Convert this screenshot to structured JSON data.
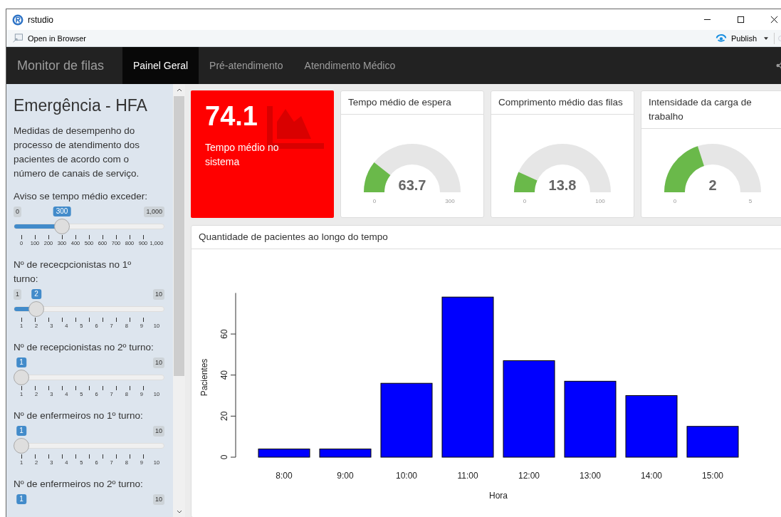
{
  "window": {
    "title": "rstudio"
  },
  "toolbar": {
    "open_in_browser": "Open in Browser",
    "publish": "Publish"
  },
  "navbar": {
    "brand": "Monitor de filas",
    "tabs": [
      {
        "label": "Painel Geral",
        "selected": true
      },
      {
        "label": "Pré-atendimento",
        "selected": false
      },
      {
        "label": "Atendimento Médico",
        "selected": false
      }
    ]
  },
  "sidebar": {
    "title": "Emergência - HFA",
    "description": "Medidas de desempenho do processo de atendimento dos pacientes de acordo com o número de canais de serviço.",
    "sliders": [
      {
        "label": "Aviso se tempo médio exceder:",
        "min": "0",
        "max": "1,000",
        "value": "300",
        "level": 0.3,
        "ticks": [
          "0",
          "100",
          "200",
          "300",
          "400",
          "500",
          "600",
          "700",
          "800",
          "900",
          "1,000"
        ]
      },
      {
        "label": "Nº de rececpcionistas no 1º turno:",
        "min": "1",
        "max": "10",
        "value": "2",
        "level": 0.111,
        "ticks": [
          "1",
          "2",
          "3",
          "4",
          "5",
          "6",
          "7",
          "8",
          "9",
          "10"
        ]
      },
      {
        "label": "Nº de recepcionistas no 2º turno:",
        "max": "10",
        "value": "1",
        "level": 0,
        "ticks": [
          "1",
          "2",
          "3",
          "4",
          "5",
          "6",
          "7",
          "8",
          "9",
          "10"
        ]
      },
      {
        "label": "Nº de enfermeiros no 1º turno:",
        "max": "10",
        "value": "1",
        "level": 0,
        "ticks": [
          "1",
          "2",
          "3",
          "4",
          "5",
          "6",
          "7",
          "8",
          "9",
          "10"
        ]
      },
      {
        "label": "Nº de enfermeiros no 2º turno:",
        "max": "10",
        "value": "1"
      }
    ]
  },
  "value_box": {
    "value": "74.1",
    "caption": "Tempo médio no sistema",
    "color": "#ff0000"
  },
  "gauges": [
    {
      "title": "Tempo médio de espera",
      "value": "63.7",
      "min": "0",
      "max": "300",
      "level": 0.212
    },
    {
      "title": "Comprimento médio das filas",
      "value": "13.8",
      "min": "0",
      "max": "100",
      "level": 0.138
    },
    {
      "title": "Intensidade da carga de trabalho",
      "value": "2",
      "min": "0",
      "max": "5",
      "level": 0.4
    }
  ],
  "chart_panel": {
    "title": "Quantidade de pacientes ao longo do tempo",
    "chart_data": {
      "type": "bar",
      "xlabel": "Hora",
      "ylabel": "Pacientes",
      "categories": [
        "8:00",
        "9:00",
        "10:00",
        "11:00",
        "12:00",
        "13:00",
        "14:00",
        "15:00"
      ],
      "values": [
        4,
        4,
        36,
        78,
        47,
        37,
        30,
        15
      ],
      "ylim": [
        0,
        80
      ],
      "yticks": [
        0,
        20,
        40,
        60
      ]
    }
  }
}
